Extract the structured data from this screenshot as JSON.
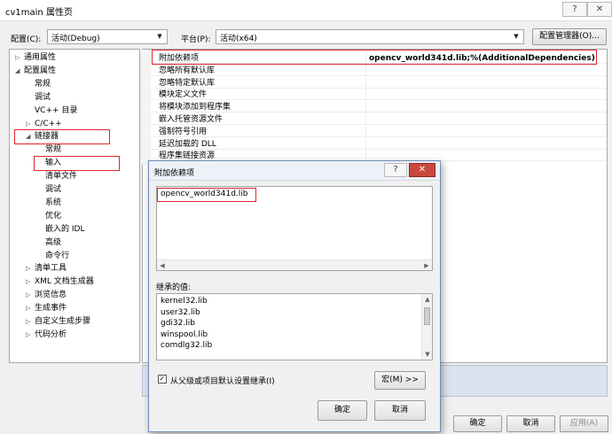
{
  "window": {
    "title": "cv1main 属性页",
    "help_glyph": "?",
    "close_glyph": "✕"
  },
  "toolbar": {
    "config_label": "配置(C):",
    "config_value": "活动(Debug)",
    "platform_label": "平台(P):",
    "platform_value": "活动(x64)",
    "config_manager_button": "配置管理器(O)..."
  },
  "tree": {
    "items": [
      {
        "label": "通用属性",
        "arrow": "▷",
        "indent": 0
      },
      {
        "label": "配置属性",
        "arrow": "◢",
        "indent": 0
      },
      {
        "label": "常规",
        "arrow": "",
        "indent": 1
      },
      {
        "label": "调试",
        "arrow": "",
        "indent": 1
      },
      {
        "label": "VC++ 目录",
        "arrow": "",
        "indent": 1
      },
      {
        "label": "C/C++",
        "arrow": "▷",
        "indent": 1
      },
      {
        "label": "链接器",
        "arrow": "◢",
        "indent": 1
      },
      {
        "label": "常规",
        "arrow": "",
        "indent": 2
      },
      {
        "label": "输入",
        "arrow": "",
        "indent": 2
      },
      {
        "label": "清单文件",
        "arrow": "",
        "indent": 2
      },
      {
        "label": "调试",
        "arrow": "",
        "indent": 2
      },
      {
        "label": "系统",
        "arrow": "",
        "indent": 2
      },
      {
        "label": "优化",
        "arrow": "",
        "indent": 2
      },
      {
        "label": "嵌入的 IDL",
        "arrow": "",
        "indent": 2
      },
      {
        "label": "高级",
        "arrow": "",
        "indent": 2
      },
      {
        "label": "命令行",
        "arrow": "",
        "indent": 2
      },
      {
        "label": "清单工具",
        "arrow": "▷",
        "indent": 1
      },
      {
        "label": "XML 文档生成器",
        "arrow": "▷",
        "indent": 1
      },
      {
        "label": "浏览信息",
        "arrow": "▷",
        "indent": 1
      },
      {
        "label": "生成事件",
        "arrow": "▷",
        "indent": 1
      },
      {
        "label": "自定义生成步骤",
        "arrow": "▷",
        "indent": 1
      },
      {
        "label": "代码分析",
        "arrow": "▷",
        "indent": 1
      }
    ]
  },
  "properties": {
    "rows": [
      {
        "name": "附加依赖项",
        "value": "opencv_world341d.lib;%(AdditionalDependencies)"
      },
      {
        "name": "忽略所有默认库",
        "value": ""
      },
      {
        "name": "忽略特定默认库",
        "value": ""
      },
      {
        "name": "模块定义文件",
        "value": ""
      },
      {
        "name": "将模块添加到程序集",
        "value": ""
      },
      {
        "name": "嵌入托管资源文件",
        "value": ""
      },
      {
        "name": "强制符号引用",
        "value": ""
      },
      {
        "name": "延迟加载的 DLL",
        "value": ""
      },
      {
        "name": "程序集链接资源",
        "value": ""
      }
    ]
  },
  "dialog": {
    "title": "附加依赖项",
    "help_glyph": "?",
    "close_glyph": "✕",
    "edit_value": "opencv_world341d.lib",
    "inherited_label": "继承的值:",
    "inherited": [
      "kernel32.lib",
      "user32.lib",
      "gdi32.lib",
      "winspool.lib",
      "comdlg32.lib"
    ],
    "inherit_checkbox_label": "从父级或项目默认设置继承(I)",
    "inherit_checked": true,
    "check_glyph": "✓",
    "macro_button": "宏(M) >>",
    "ok_button": "确定",
    "cancel_button": "取消"
  },
  "bottom": {
    "ok_button": "确定",
    "cancel_button": "取消",
    "apply_button": "应用(A)"
  },
  "colors": {
    "highlight_red": "#e0262a",
    "dialog_border": "#6f8db7"
  }
}
